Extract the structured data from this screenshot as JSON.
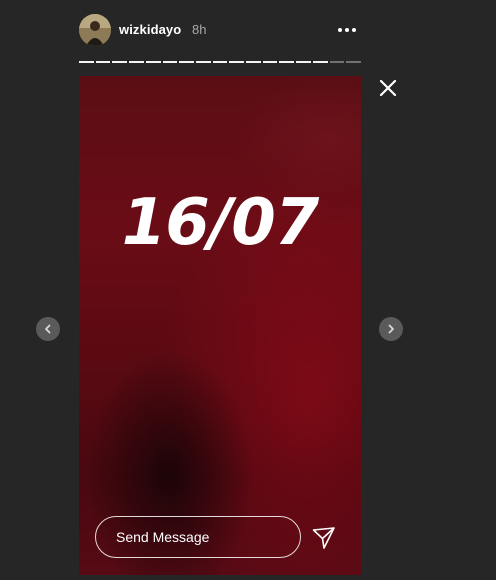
{
  "header": {
    "username": "wizkidayo",
    "timestamp": "8h",
    "more_icon": "more-horizontal-icon"
  },
  "progress": {
    "total_segments": 17,
    "current_segment": 15
  },
  "story": {
    "text": "16/07",
    "background_color": "#5a0e14"
  },
  "reply": {
    "placeholder": "Send Message",
    "value": ""
  },
  "icons": {
    "close": "close-icon",
    "send": "send-icon",
    "prev": "chevron-left-icon",
    "next": "chevron-right-icon"
  },
  "colors": {
    "background": "#262626",
    "text": "#ffffff",
    "muted": "#a8a8a8"
  }
}
